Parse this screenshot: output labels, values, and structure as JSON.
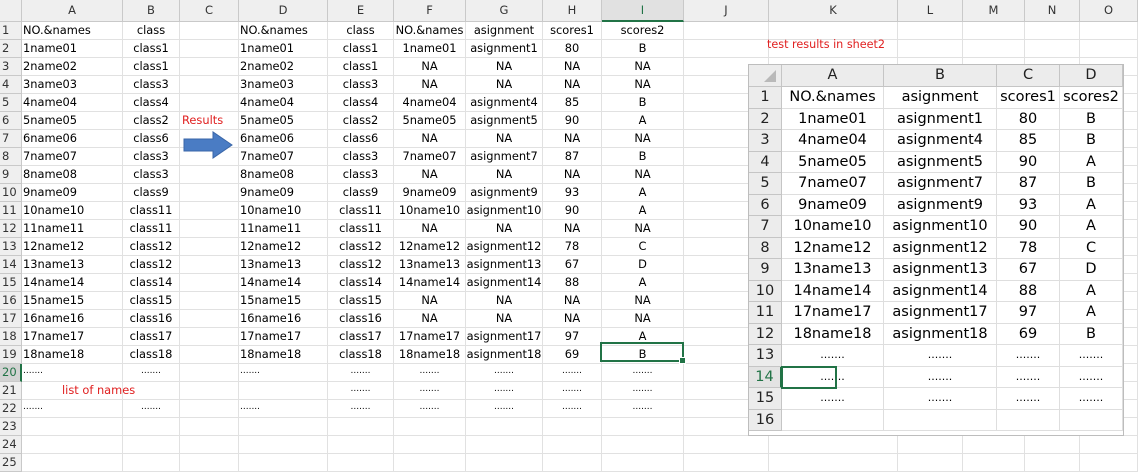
{
  "sheet": {
    "columns": [
      "A",
      "B",
      "C",
      "D",
      "E",
      "F",
      "G",
      "H",
      "I",
      "J",
      "K",
      "L",
      "M",
      "N",
      "O"
    ],
    "rows": [
      "1",
      "2",
      "3",
      "4",
      "5",
      "6",
      "7",
      "8",
      "9",
      "10",
      "11",
      "12",
      "13",
      "14",
      "15",
      "16",
      "17",
      "18",
      "19",
      "20",
      "21",
      "22",
      "23",
      "24",
      "25"
    ],
    "selected_column": "I",
    "selected_row": "20",
    "accent_color": "#217346",
    "note_color": "#e02020",
    "cells": [
      [
        "NO.&names",
        "class",
        "",
        "NO.&names",
        "class",
        "NO.&names",
        "asignment",
        "scores1",
        "scores2"
      ],
      [
        "1name01",
        "class1",
        "",
        "1name01",
        "class1",
        "1name01",
        "asignment1",
        "80",
        "B"
      ],
      [
        "2name02",
        "class1",
        "",
        "2name02",
        "class1",
        "NA",
        "NA",
        "NA",
        "NA"
      ],
      [
        "3name03",
        "class3",
        "",
        "3name03",
        "class3",
        "NA",
        "NA",
        "NA",
        "NA"
      ],
      [
        "4name04",
        "class4",
        "",
        "4name04",
        "class4",
        "4name04",
        "asignment4",
        "85",
        "B"
      ],
      [
        "5name05",
        "class2",
        "Results",
        "5name05",
        "class2",
        "5name05",
        "asignment5",
        "90",
        "A"
      ],
      [
        "6name06",
        "class6",
        "",
        "6name06",
        "class6",
        "NA",
        "NA",
        "NA",
        "NA"
      ],
      [
        "7name07",
        "class3",
        "",
        "7name07",
        "class3",
        "7name07",
        "asignment7",
        "87",
        "B"
      ],
      [
        "8name08",
        "class3",
        "",
        "8name08",
        "class3",
        "NA",
        "NA",
        "NA",
        "NA"
      ],
      [
        "9name09",
        "class9",
        "",
        "9name09",
        "class9",
        "9name09",
        "asignment9",
        "93",
        "A"
      ],
      [
        "10name10",
        "class11",
        "",
        "10name10",
        "class11",
        "10name10",
        "asignment10",
        "90",
        "A"
      ],
      [
        "11name11",
        "class11",
        "",
        "11name11",
        "class11",
        "NA",
        "NA",
        "NA",
        "NA"
      ],
      [
        "12name12",
        "class12",
        "",
        "12name12",
        "class12",
        "12name12",
        "asignment12",
        "78",
        "C"
      ],
      [
        "13name13",
        "class12",
        "",
        "13name13",
        "class12",
        "13name13",
        "asignment13",
        "67",
        "D"
      ],
      [
        "14name14",
        "class14",
        "",
        "14name14",
        "class14",
        "14name14",
        "asignment14",
        "88",
        "A"
      ],
      [
        "15name15",
        "class15",
        "",
        "15name15",
        "class15",
        "NA",
        "NA",
        "NA",
        "NA"
      ],
      [
        "16name16",
        "class16",
        "",
        "16name16",
        "class16",
        "NA",
        "NA",
        "NA",
        "NA"
      ],
      [
        "17name17",
        "class17",
        "",
        "17name17",
        "class17",
        "17name17",
        "asignment17",
        "97",
        "A"
      ],
      [
        "18name18",
        "class18",
        "",
        "18name18",
        "class18",
        "18name18",
        "asignment18",
        "69",
        "B"
      ],
      [
        ".......",
        ".......",
        "",
        ".......",
        ".......",
        ".......",
        ".......",
        ".......",
        "......."
      ],
      [
        "list of names",
        "",
        "",
        "",
        ".......",
        ".......",
        ".......",
        ".......",
        "......."
      ],
      [
        ".......",
        ".......",
        "",
        ".......",
        ".......",
        ".......",
        ".......",
        ".......",
        "......."
      ]
    ],
    "note_sheet2": "test results in sheet2",
    "icons": {
      "results_arrow": "right-arrow-icon"
    }
  },
  "sheet2_picture": {
    "columns": [
      "A",
      "B",
      "C",
      "D"
    ],
    "rows": [
      "1",
      "2",
      "3",
      "4",
      "5",
      "6",
      "7",
      "8",
      "9",
      "10",
      "11",
      "12",
      "13",
      "14",
      "15",
      "16"
    ],
    "selected_row": "14",
    "cells": [
      [
        "NO.&names",
        "asignment",
        "scores1",
        "scores2"
      ],
      [
        "1name01",
        "asignment1",
        "80",
        "B"
      ],
      [
        "4name04",
        "asignment4",
        "85",
        "B"
      ],
      [
        "5name05",
        "asignment5",
        "90",
        "A"
      ],
      [
        "7name07",
        "asignment7",
        "87",
        "B"
      ],
      [
        "9name09",
        "asignment9",
        "93",
        "A"
      ],
      [
        "10name10",
        "asignment10",
        "90",
        "A"
      ],
      [
        "12name12",
        "asignment12",
        "78",
        "C"
      ],
      [
        "13name13",
        "asignment13",
        "67",
        "D"
      ],
      [
        "14name14",
        "asignment14",
        "88",
        "A"
      ],
      [
        "17name17",
        "asignment17",
        "97",
        "A"
      ],
      [
        "18name18",
        "asignment18",
        "69",
        "B"
      ],
      [
        ".......",
        ".......",
        ".......",
        "......."
      ],
      [
        ".......",
        ".......",
        ".......",
        "......."
      ],
      [
        ".......",
        ".......",
        ".......",
        "......."
      ],
      [
        "",
        "",
        "",
        ""
      ]
    ]
  }
}
